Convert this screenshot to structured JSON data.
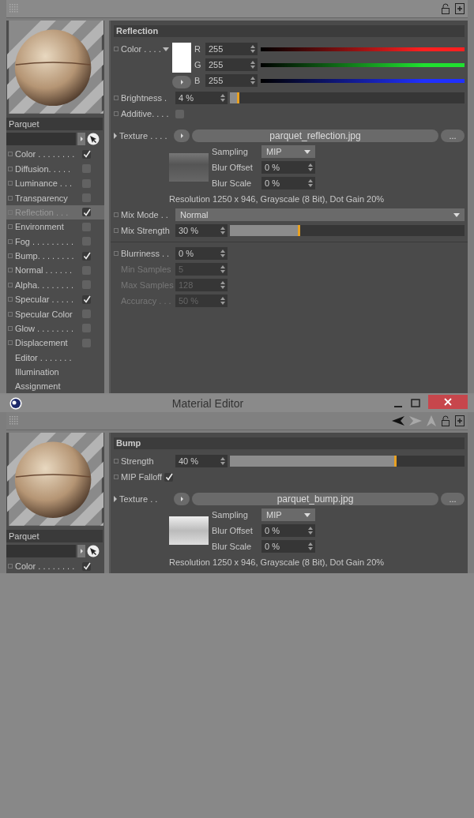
{
  "upper_editor": {
    "material_name": "Parquet",
    "channels": [
      {
        "kind": "toggle",
        "label": "Color . . . . . . . .",
        "checked": true,
        "selected": false
      },
      {
        "kind": "toggle",
        "label": "Diffusion. . . . .",
        "checked": false,
        "selected": false
      },
      {
        "kind": "toggle",
        "label": "Luminance . . .",
        "checked": false,
        "selected": false
      },
      {
        "kind": "toggle",
        "label": "Transparency",
        "checked": false,
        "selected": false
      },
      {
        "kind": "toggle",
        "label": "Reflection . . .",
        "checked": true,
        "selected": true
      },
      {
        "kind": "toggle",
        "label": "Environment",
        "checked": false,
        "selected": false
      },
      {
        "kind": "toggle",
        "label": "Fog . . . . . . . . .",
        "checked": false,
        "selected": false
      },
      {
        "kind": "toggle",
        "label": "Bump. . . . . . . .",
        "checked": true,
        "selected": false
      },
      {
        "kind": "toggle",
        "label": "Normal . . . . . .",
        "checked": false,
        "selected": false
      },
      {
        "kind": "toggle",
        "label": "Alpha. . . . . . . .",
        "checked": false,
        "selected": false
      },
      {
        "kind": "toggle",
        "label": "Specular . . . . .",
        "checked": true,
        "selected": false
      },
      {
        "kind": "toggle",
        "label": "Specular Color",
        "checked": false,
        "selected": false
      },
      {
        "kind": "toggle",
        "label": "Glow . . . . . . . .",
        "checked": false,
        "selected": false
      },
      {
        "kind": "toggle",
        "label": "Displacement",
        "checked": false,
        "selected": false
      },
      {
        "kind": "plain",
        "label": "Editor . . . . . . .",
        "selected": false
      },
      {
        "kind": "plain",
        "label": "Illumination",
        "selected": false
      },
      {
        "kind": "plain",
        "label": "Assignment",
        "selected": false
      }
    ],
    "section_title": "Reflection",
    "color": {
      "label": "Color . . . .",
      "components": [
        {
          "label": "R",
          "value": "255",
          "level": 1,
          "color": "#ff2020"
        },
        {
          "label": "G",
          "value": "255",
          "level": 1,
          "color": "#20e030"
        },
        {
          "label": "B",
          "value": "255",
          "level": 1,
          "color": "#2030ff"
        }
      ]
    },
    "brightness": {
      "label": "Brightness .",
      "value": "4 %",
      "level": 0.04
    },
    "additive": {
      "label": "Additive. . . .",
      "checked": false
    },
    "texture": {
      "label": "Texture . . . .",
      "file": "parquet_reflection.jpg",
      "browse": "...",
      "params": [
        {
          "kind": "dropdown",
          "label": "Sampling",
          "value": "MIP"
        },
        {
          "kind": "number",
          "label": "Blur Offset",
          "value": "0 %"
        },
        {
          "kind": "number",
          "label": "Blur Scale",
          "value": "0 %"
        }
      ],
      "resolution": "Resolution 1250 x 946, Grayscale (8 Bit), Dot Gain 20%"
    },
    "mix_mode": {
      "label": "Mix Mode . .",
      "value": "Normal"
    },
    "mix_strength": {
      "label": "Mix Strength",
      "value": "30 %",
      "level": 0.3
    },
    "blur_params": [
      {
        "label": "Blurriness . .",
        "value": "0 %",
        "disabled": false
      },
      {
        "label": "Min Samples",
        "value": "5",
        "disabled": true
      },
      {
        "label": "Max Samples",
        "value": "128",
        "disabled": true
      },
      {
        "label": "Accuracy . . .",
        "value": "50 %",
        "disabled": true
      }
    ]
  },
  "lower_editor": {
    "window_title": "Material Editor",
    "material_name": "Parquet",
    "channels": [
      {
        "kind": "toggle",
        "label": "Color . . . . . . . .",
        "checked": true,
        "selected": false
      }
    ],
    "section_title": "Bump",
    "strength": {
      "label": "Strength",
      "value": "40 %",
      "level": 0.71
    },
    "mip_falloff": {
      "label": "MIP Falloff",
      "checked": true
    },
    "texture": {
      "label": "Texture . .",
      "file": "parquet_bump.jpg",
      "browse": "...",
      "params": [
        {
          "kind": "dropdown",
          "label": "Sampling",
          "value": "MIP"
        },
        {
          "kind": "number",
          "label": "Blur Offset",
          "value": "0 %"
        },
        {
          "kind": "number",
          "label": "Blur Scale",
          "value": "0 %"
        }
      ],
      "resolution": "Resolution 1250 x 946, Grayscale (8 Bit), Dot Gain 20%"
    }
  }
}
